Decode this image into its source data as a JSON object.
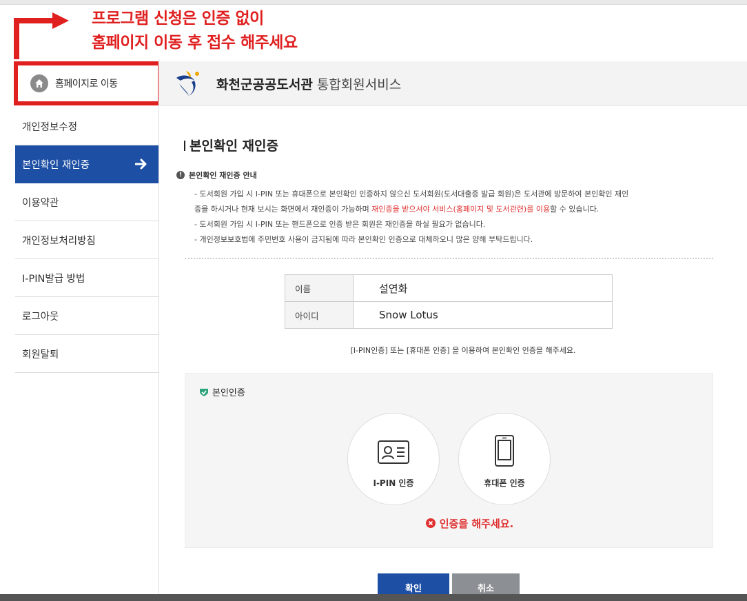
{
  "notice": {
    "line1": "프로그램 신청은 인증 없이",
    "line2": "홈페이지 이동 후 접수 해주세요"
  },
  "home_button": {
    "label": "홈페이지로 이동",
    "icon": "home-icon"
  },
  "header": {
    "library_name": "화천군공공도서관",
    "service_name": "통합회원서비스"
  },
  "sidebar": {
    "items": [
      {
        "label": "개인정보수정"
      },
      {
        "label": "본인확인 재인증",
        "active": true
      },
      {
        "label": "이용약관"
      },
      {
        "label": "개인정보처리방침"
      },
      {
        "label": "I-PIN발급 방법"
      },
      {
        "label": "로그아웃"
      },
      {
        "label": "회원탈퇴"
      }
    ]
  },
  "main": {
    "title": "본인확인 재인증",
    "guide_title": "본인확인 재인증 안내",
    "guide": {
      "line1a": "- 도서회원 가입 시 I-PIN 또는 휴대폰으로 본인확인 인증하지 않으신 도서회원(도서대출증 발급 회원)은 도서관에 방문하여 본인확인 재인",
      "line1b": "증을 하시거나 현재 보시는 화면에서 재인증이 가능하며 ",
      "line1_red": "재인증을 받으셔야 서비스(홈페이지 및 도서관련)를 이용",
      "line1c": "할 수 있습니다.",
      "line2": "- 도서회원 가입 시 I-PIN 또는 핸드폰으로 인증 받은 회원은 재인증을 하실 필요가 없습니다.",
      "line3": "- 개인정보보호법에 주민번호 사용이 금지됨에 따라 본인확인 인증으로 대체하오니 많은 양해 부탁드립니다."
    },
    "info_table": {
      "rows": [
        {
          "key": "이름",
          "value": "설연화"
        },
        {
          "key": "아이디",
          "value": "Snow Lotus"
        }
      ]
    },
    "instruction": "[I-PIN인증] 또는 [휴대폰 인증] 을 이용하여 본인확인 인증을 해주세요.",
    "verify": {
      "title": "본인인증",
      "ipin_label": "I-PIN 인증",
      "phone_label": "휴대폰 인증",
      "error": "인증을 해주세요."
    },
    "buttons": {
      "ok": "확인",
      "cancel": "취소"
    }
  },
  "colors": {
    "accent": "#1d4fa4",
    "alert": "#e02020",
    "success": "#2ba37a"
  }
}
